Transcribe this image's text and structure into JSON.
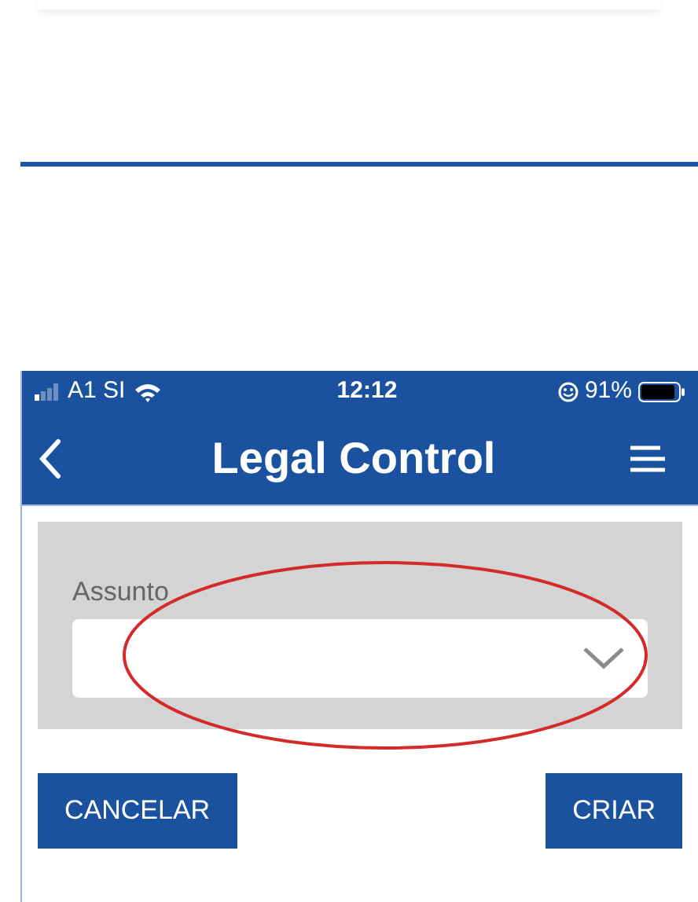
{
  "status_bar": {
    "carrier": "A1 SI",
    "time": "12:12",
    "battery": "91%"
  },
  "header": {
    "title": "Legal Control"
  },
  "form": {
    "label": "Assunto"
  },
  "buttons": [
    {
      "label": "CANCELAR"
    },
    {
      "label": "CRIAR"
    }
  ]
}
